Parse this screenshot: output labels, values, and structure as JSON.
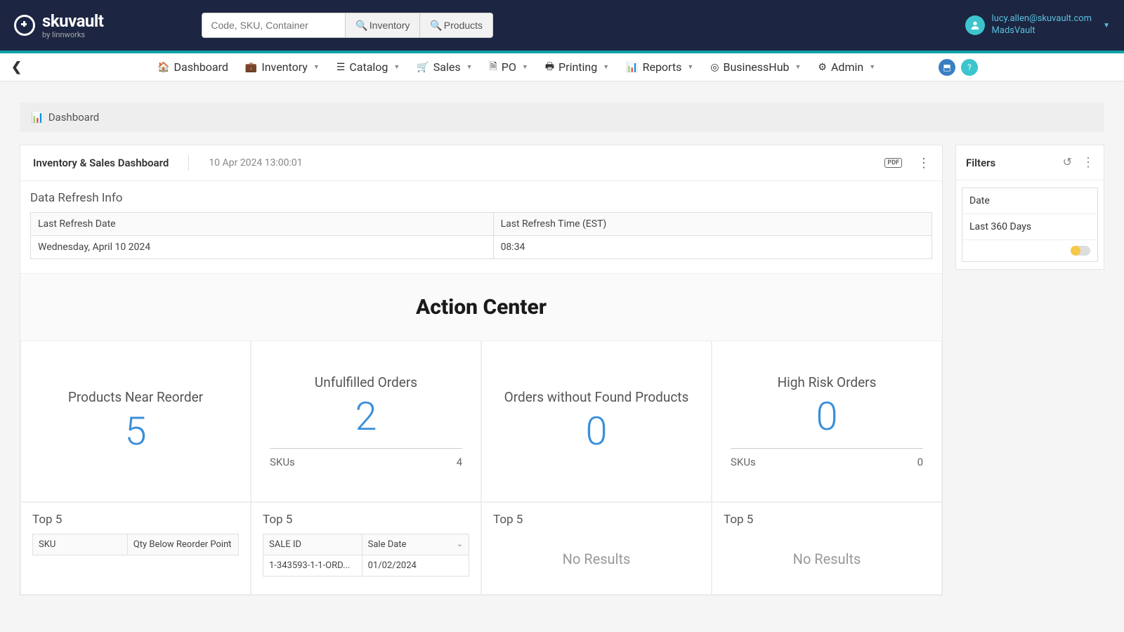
{
  "brand": {
    "name": "skuvault",
    "by": "by linnworks"
  },
  "search": {
    "placeholder": "Code, SKU, Container",
    "btn_inventory": "Inventory",
    "btn_products": "Products"
  },
  "user": {
    "email": "lucy.allen@skuvault.com",
    "tenant": "MadsVault"
  },
  "nav": {
    "dashboard": "Dashboard",
    "inventory": "Inventory",
    "catalog": "Catalog",
    "sales": "Sales",
    "po": "PO",
    "printing": "Printing",
    "reports": "Reports",
    "businesshub": "BusinessHub",
    "admin": "Admin"
  },
  "breadcrumb": "Dashboard",
  "dashboard": {
    "title": "Inventory & Sales Dashboard",
    "timestamp": "10 Apr 2024 13:00:01",
    "pdf": "PDF"
  },
  "refresh": {
    "heading": "Data Refresh Info",
    "col1": "Last Refresh Date",
    "col2": "Last Refresh Time (EST)",
    "val1": "Wednesday, April 10 2024",
    "val2": "08:34"
  },
  "action_center": {
    "title": "Action Center",
    "cards": [
      {
        "title": "Products Near Reorder",
        "value": "5"
      },
      {
        "title": "Unfulfilled Orders",
        "value": "2",
        "sub_label": "SKUs",
        "sub_value": "4"
      },
      {
        "title": "Orders without Found Products",
        "value": "0"
      },
      {
        "title": "High Risk Orders",
        "value": "0",
        "sub_label": "SKUs",
        "sub_value": "0"
      }
    ]
  },
  "top5": {
    "label": "Top 5",
    "reorder": {
      "col1": "SKU",
      "col2": "Qty Below Reorder Point"
    },
    "unfulfilled": {
      "col1": "SALE ID",
      "col2": "Sale Date",
      "row1_id": "1-343593-1-1-ORD...",
      "row1_date": "01/02/2024"
    },
    "no_results": "No Results"
  },
  "filters": {
    "title": "Filters",
    "date_label": "Date",
    "date_value": "Last 360 Days"
  }
}
